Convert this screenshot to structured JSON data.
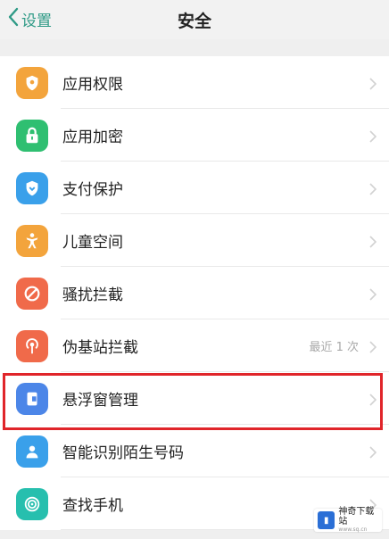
{
  "header": {
    "back_label": "设置",
    "title": "安全"
  },
  "items": [
    {
      "label": "应用权限",
      "icon": "shield-icon",
      "color": "#f3a43c",
      "value": ""
    },
    {
      "label": "应用加密",
      "icon": "lock-icon",
      "color": "#2fbf71",
      "value": ""
    },
    {
      "label": "支付保护",
      "icon": "payment-shield-icon",
      "color": "#3aa0ea",
      "value": ""
    },
    {
      "label": "儿童空间",
      "icon": "child-icon",
      "color": "#f3a43c",
      "value": ""
    },
    {
      "label": "骚扰拦截",
      "icon": "block-icon",
      "color": "#f06a4a",
      "value": ""
    },
    {
      "label": "伪基站拦截",
      "icon": "antenna-icon",
      "color": "#f06a4a",
      "value": "最近 1 次"
    },
    {
      "label": "悬浮窗管理",
      "icon": "floating-window-icon",
      "color": "#4c86e8",
      "value": ""
    },
    {
      "label": "智能识别陌生号码",
      "icon": "contact-icon",
      "color": "#3aa0ea",
      "value": ""
    },
    {
      "label": "查找手机",
      "icon": "find-phone-icon",
      "color": "#27bfae",
      "value": ""
    }
  ],
  "watermark": {
    "title": "神奇下载站",
    "url": "www.sq.cn"
  },
  "colors": {
    "accent": "#2f9a86",
    "highlight_border": "#e0252a"
  }
}
